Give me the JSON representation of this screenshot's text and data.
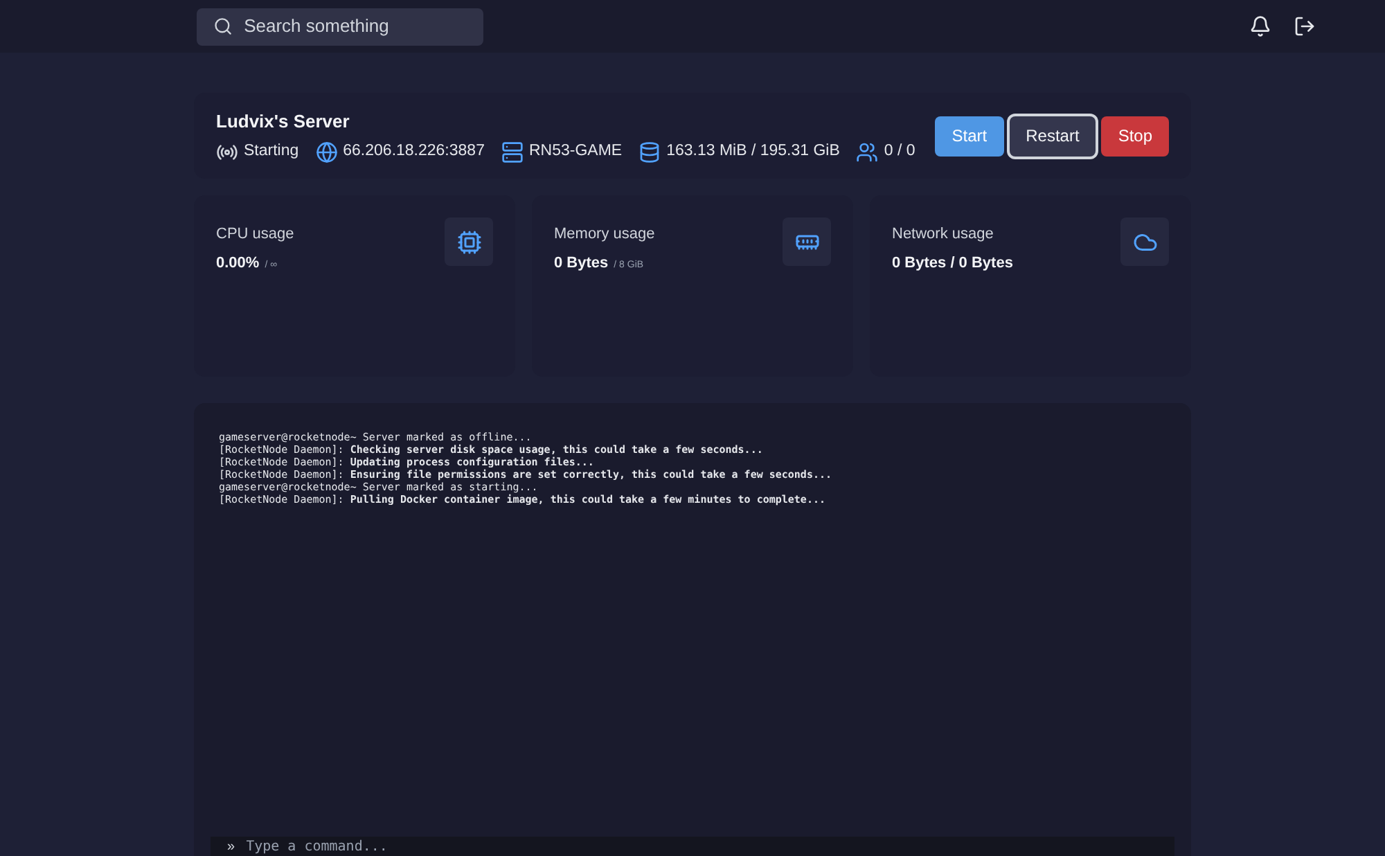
{
  "topbar": {
    "search": {
      "placeholder": "Search something"
    }
  },
  "server": {
    "name": "Ludvix's Server",
    "details": [
      {
        "kind": "status",
        "text": "Starting"
      },
      {
        "kind": "address",
        "text": "66.206.18.226:3887"
      },
      {
        "kind": "node",
        "text": "RN53-GAME"
      },
      {
        "kind": "disk",
        "text": "163.13 MiB / 195.31 GiB"
      },
      {
        "kind": "players",
        "text": "0 / 0"
      }
    ],
    "buttons": [
      {
        "kind": "start",
        "label": "Start",
        "focused": false
      },
      {
        "kind": "restart",
        "label": "Restart",
        "focused": true
      },
      {
        "kind": "stop",
        "label": "Stop",
        "focused": false
      }
    ]
  },
  "stats": [
    {
      "kind": "cpu",
      "label": "CPU usage",
      "value": "0.00%",
      "limit": "/ ∞"
    },
    {
      "kind": "memory",
      "label": "Memory usage",
      "value": "0 Bytes",
      "limit": "/ 8 GiB"
    },
    {
      "kind": "network",
      "label": "Network usage",
      "value": "0 Bytes / 0 Bytes"
    }
  ],
  "console": {
    "lines": [
      "gameserver@rocketnode~ Server marked as offline...",
      "[RocketNode Daemon]: **Checking server disk space usage, this could take a few seconds...**",
      "[RocketNode Daemon]: **Updating process configuration files...**",
      "[RocketNode Daemon]: **Ensuring file permissions are set correctly, this could take a few seconds...**",
      "gameserver@rocketnode~ Server marked as starting...",
      "[RocketNode Daemon]: **Pulling Docker container image, this could take a few minutes to complete...**"
    ],
    "prompt": "»",
    "placeholder": "Type a command..."
  }
}
